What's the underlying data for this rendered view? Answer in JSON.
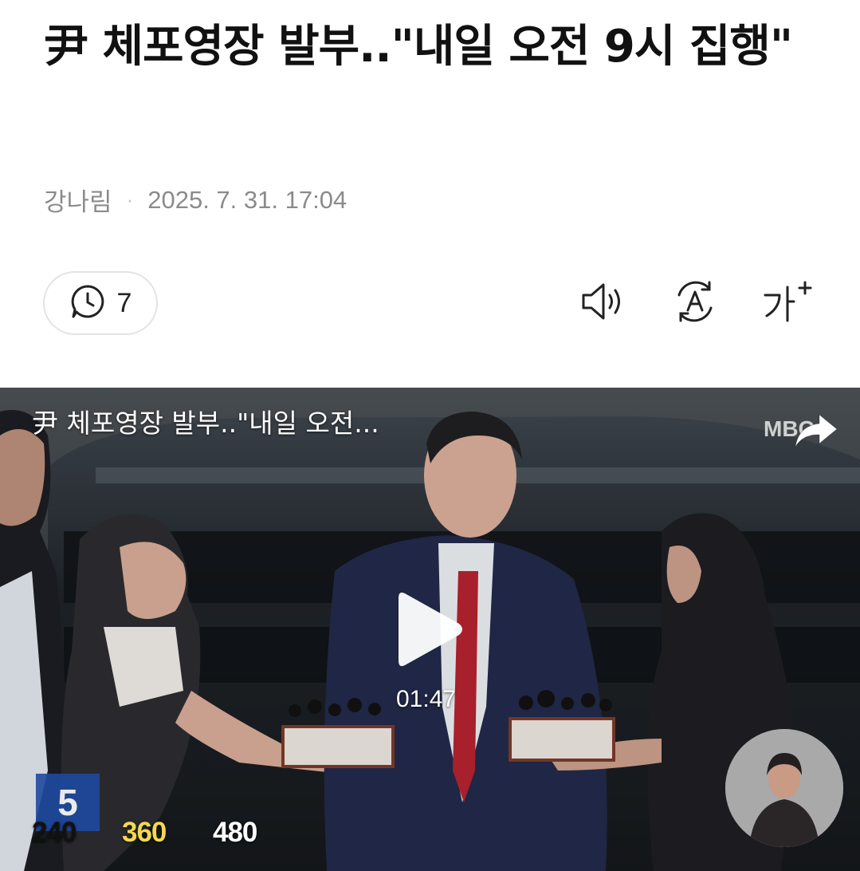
{
  "article": {
    "headline": "尹 체포영장 발부..\"내일 오전 9시 집행\"",
    "author": "강나림",
    "separator": "·",
    "datetime": "2025. 7. 31. 17:04"
  },
  "toolbar": {
    "comment_count": "7",
    "icons": [
      "comment-icon",
      "speaker-icon",
      "auto-translate-icon",
      "font-size-icon"
    ]
  },
  "video": {
    "title": "尹 체포영장 발부..\"내일 오전...",
    "duration": "01:47",
    "channel_number": "5",
    "qualities": [
      "240",
      "360",
      "480"
    ],
    "selected_quality": "360",
    "watermark": "MBC"
  },
  "colors": {
    "selected_quality": "#f2d94e",
    "unselected_quality": "#ffffff",
    "meta_text": "#8b8b8b"
  }
}
